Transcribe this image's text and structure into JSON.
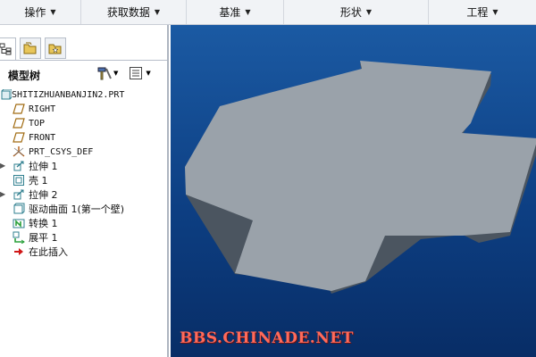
{
  "menubar": {
    "items": [
      {
        "label": "操作"
      },
      {
        "label": "获取数据"
      },
      {
        "label": "基准"
      },
      {
        "label": "形状"
      },
      {
        "label": "工程"
      }
    ]
  },
  "model_tree": {
    "title": "模型树",
    "root": "SHITIZHUANBANJIN2.PRT",
    "items": [
      {
        "label": "RIGHT",
        "icon": "datum-plane-icon"
      },
      {
        "label": "TOP",
        "icon": "datum-plane-icon"
      },
      {
        "label": "FRONT",
        "icon": "datum-plane-icon"
      },
      {
        "label": "PRT_CSYS_DEF",
        "icon": "coordinate-system-icon"
      },
      {
        "label": "拉伸 1",
        "icon": "extrude-icon",
        "expandable": true
      },
      {
        "label": "壳 1",
        "icon": "shell-icon"
      },
      {
        "label": "拉伸 2",
        "icon": "extrude-icon",
        "expandable": true
      },
      {
        "label": "驱动曲面 1(第一个壁)",
        "icon": "driving-surface-icon"
      },
      {
        "label": "转换 1",
        "icon": "conversion-icon"
      },
      {
        "label": "展平 1",
        "icon": "flatten-icon"
      },
      {
        "label": "在此插入",
        "icon": "insert-here-arrow-icon"
      }
    ]
  },
  "viewport": {
    "watermark": "BBS.CHINADE.NET",
    "part_color": "#9aa2aa",
    "background": "#0f4a8f"
  }
}
